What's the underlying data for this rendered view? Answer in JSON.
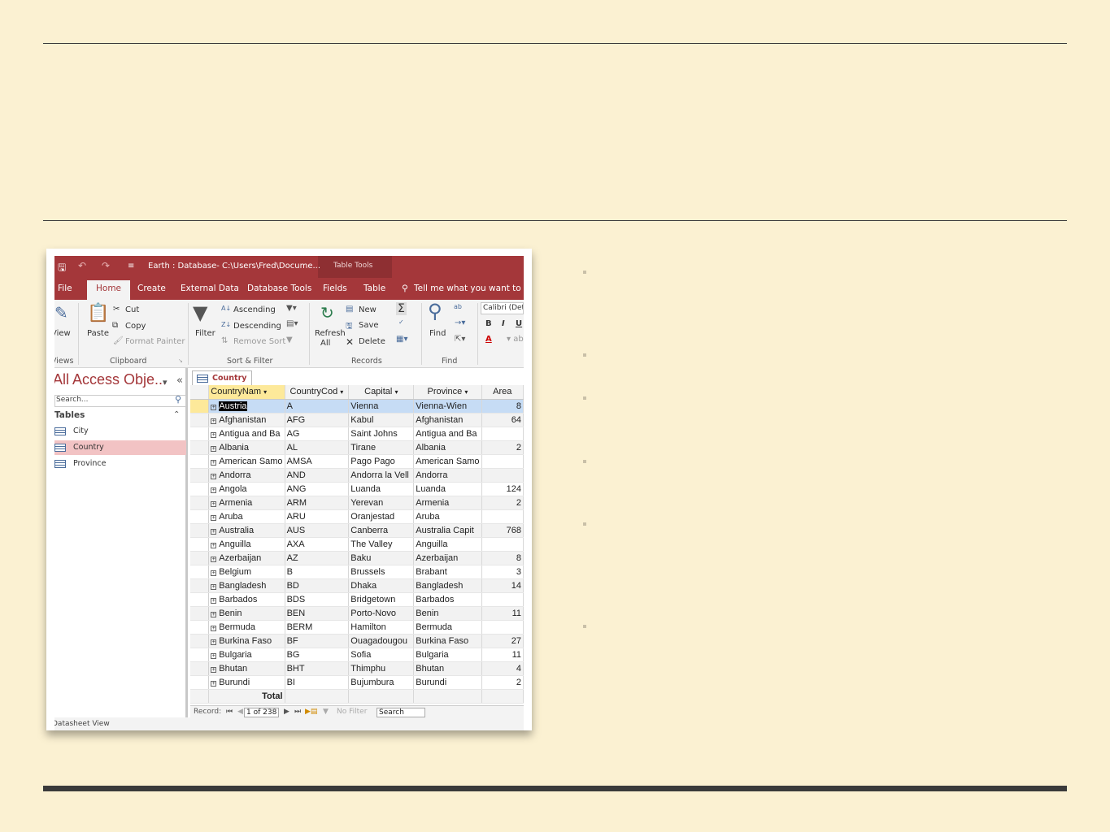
{
  "window": {
    "title": "Earth : Database- C:\\Users\\Fred\\Docume...",
    "context_tab": "Table Tools"
  },
  "menu": {
    "tabs": [
      "File",
      "Home",
      "Create",
      "External Data",
      "Database Tools",
      "Fields",
      "Table"
    ],
    "tell_me": "Tell me what you want to do"
  },
  "ribbon": {
    "views": {
      "view": "View",
      "label": "Views"
    },
    "clipboard": {
      "paste": "Paste",
      "cut": "Cut",
      "copy": "Copy",
      "format_painter": "Format Painter",
      "label": "Clipboard"
    },
    "sort_filter": {
      "filter": "Filter",
      "ascending": "Ascending",
      "descending": "Descending",
      "remove_sort": "Remove Sort",
      "label": "Sort & Filter"
    },
    "records": {
      "refresh": "Refresh",
      "refresh_all": "All",
      "new": "New",
      "save": "Save",
      "delete": "Delete",
      "label": "Records"
    },
    "find": {
      "find": "Find",
      "label": "Find"
    },
    "text": {
      "font": "Calibri (Det",
      "bold": "B",
      "italic": "I",
      "underline": "U"
    }
  },
  "nav": {
    "title": "All Access Obje...",
    "search_placeholder": "Search...",
    "section": "Tables",
    "items": [
      "City",
      "Country",
      "Province"
    ]
  },
  "doc": {
    "tab": "Country",
    "columns": [
      "CountryNam",
      "CountryCod",
      "Capital",
      "Province",
      "Area"
    ],
    "rows": [
      [
        "Austria",
        "A",
        "Vienna",
        "Vienna-Wien",
        "8"
      ],
      [
        "Afghanistan",
        "AFG",
        "Kabul",
        "Afghanistan",
        "64"
      ],
      [
        "Antigua and Ba",
        "AG",
        "Saint Johns",
        "Antigua and Ba",
        ""
      ],
      [
        "Albania",
        "AL",
        "Tirane",
        "Albania",
        "2"
      ],
      [
        "American Samo",
        "AMSA",
        "Pago Pago",
        "American Samo",
        ""
      ],
      [
        "Andorra",
        "AND",
        "Andorra la Vell",
        "Andorra",
        ""
      ],
      [
        "Angola",
        "ANG",
        "Luanda",
        "Luanda",
        "124"
      ],
      [
        "Armenia",
        "ARM",
        "Yerevan",
        "Armenia",
        "2"
      ],
      [
        "Aruba",
        "ARU",
        "Oranjestad",
        "Aruba",
        ""
      ],
      [
        "Australia",
        "AUS",
        "Canberra",
        "Australia Capit",
        "768"
      ],
      [
        "Anguilla",
        "AXA",
        "The Valley",
        "Anguilla",
        ""
      ],
      [
        "Azerbaijan",
        "AZ",
        "Baku",
        "Azerbaijan",
        "8"
      ],
      [
        "Belgium",
        "B",
        "Brussels",
        "Brabant",
        "3"
      ],
      [
        "Bangladesh",
        "BD",
        "Dhaka",
        "Bangladesh",
        "14"
      ],
      [
        "Barbados",
        "BDS",
        "Bridgetown",
        "Barbados",
        ""
      ],
      [
        "Benin",
        "BEN",
        "Porto-Novo",
        "Benin",
        "11"
      ],
      [
        "Bermuda",
        "BERM",
        "Hamilton",
        "Bermuda",
        ""
      ],
      [
        "Burkina Faso",
        "BF",
        "Ouagadougou",
        "Burkina Faso",
        "27"
      ],
      [
        "Bulgaria",
        "BG",
        "Sofia",
        "Bulgaria",
        "11"
      ],
      [
        "Bhutan",
        "BHT",
        "Thimphu",
        "Bhutan",
        "4"
      ],
      [
        "Burundi",
        "BI",
        "Bujumbura",
        "Burundi",
        "2"
      ]
    ],
    "total_label": "Total",
    "record": {
      "label": "Record:",
      "position": "1 of 238",
      "filter": "No Filter",
      "search": "Search"
    }
  },
  "statusbar": {
    "text": "Datasheet View"
  },
  "colors": {
    "brand": "#a4373a",
    "background": "#fbf1d2"
  }
}
